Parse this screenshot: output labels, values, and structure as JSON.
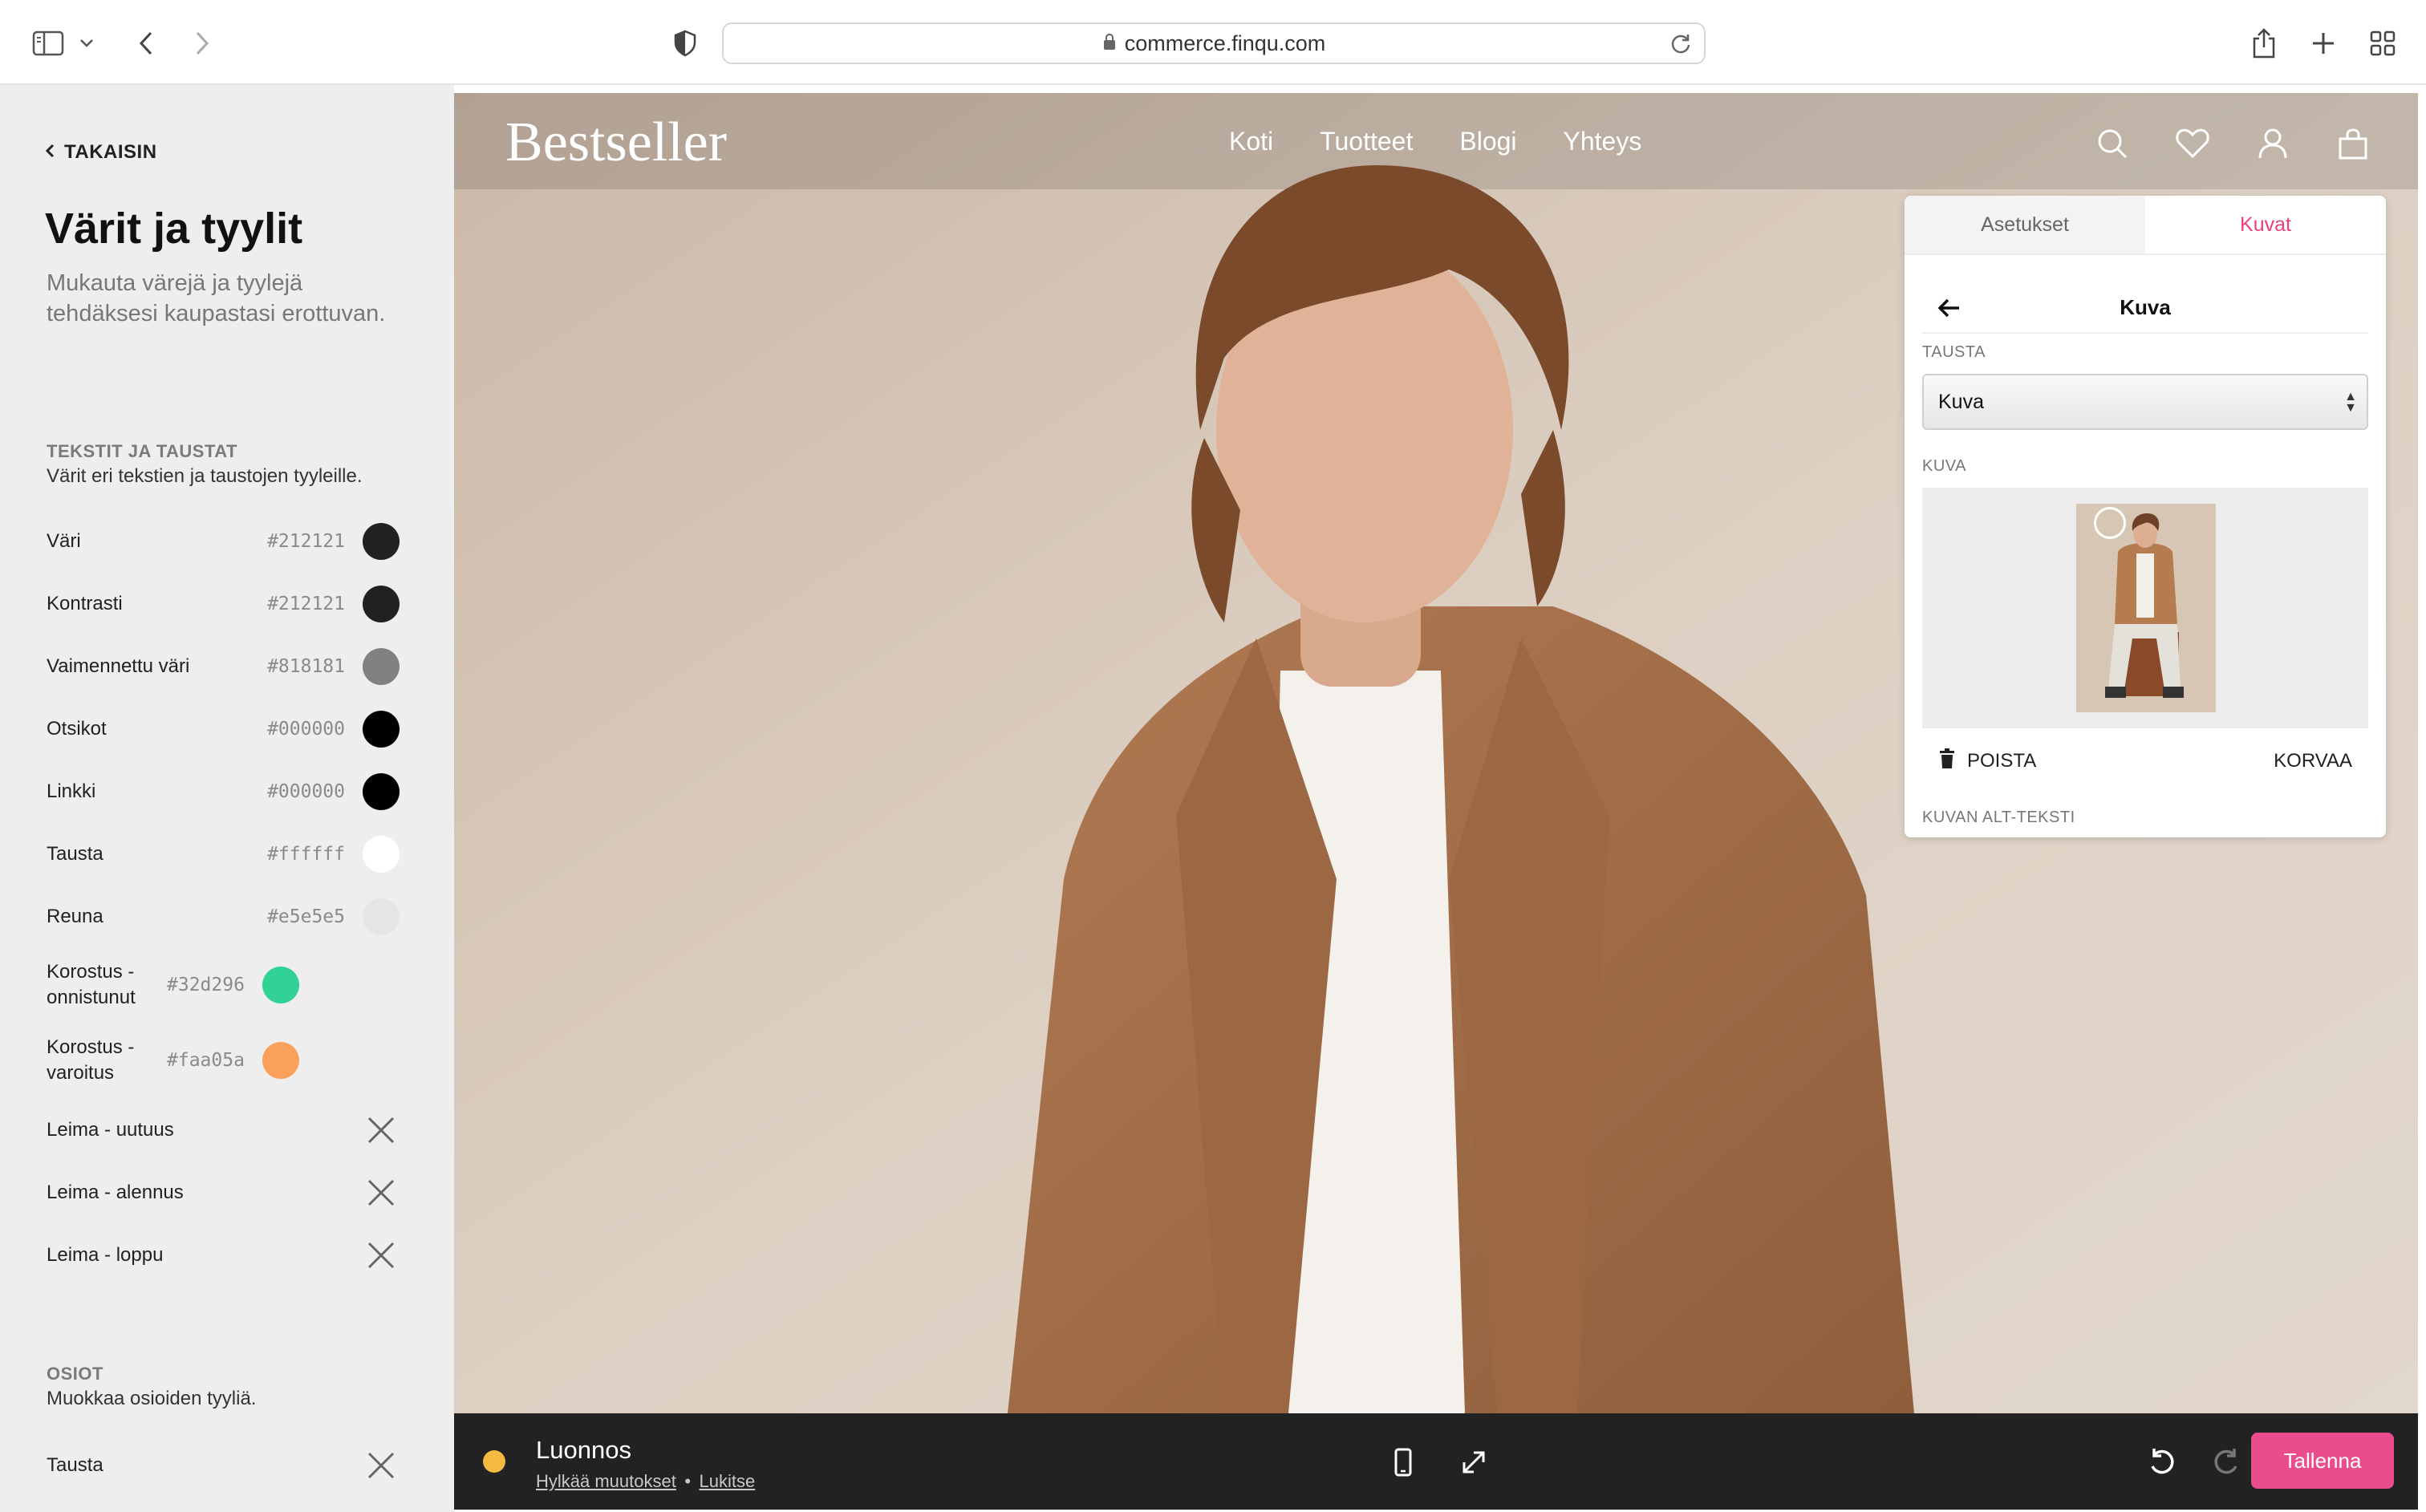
{
  "browser": {
    "url": "commerce.finqu.com",
    "icons": [
      "sidebar-toggle-icon",
      "chevron-down-icon",
      "back-icon",
      "forward-icon",
      "privacy-shield-icon",
      "lock-icon",
      "reload-icon",
      "share-icon",
      "new-tab-icon",
      "tab-overview-icon"
    ]
  },
  "sidebar": {
    "back_label": "TAKAISIN",
    "title": "Värit ja tyylit",
    "description": "Mukauta värejä ja tyylejä tehdäksesi kaupastasi erottuvan.",
    "texts_section": {
      "label": "TEKSTIT JA TAUSTAT",
      "description": "Värit eri tekstien ja taustojen tyyleille.",
      "colors": [
        {
          "label": "Väri",
          "hex": "#212121",
          "color": "#212121"
        },
        {
          "label": "Kontrasti",
          "hex": "#212121",
          "color": "#212121"
        },
        {
          "label": "Vaimennettu väri",
          "hex": "#818181",
          "color": "#818181"
        },
        {
          "label": "Otsikot",
          "hex": "#000000",
          "color": "#000000"
        },
        {
          "label": "Linkki",
          "hex": "#000000",
          "color": "#000000"
        },
        {
          "label": "Tausta",
          "hex": "#ffffff",
          "color": "#ffffff"
        },
        {
          "label": "Reuna",
          "hex": "#e5e5e5",
          "color": "#e5e5e5"
        },
        {
          "label": "Korostus - onnistunut",
          "hex": "#32d296",
          "color": "#32d296"
        },
        {
          "label": "Korostus - varoitus",
          "hex": "#faa05a",
          "color": "#faa05a"
        }
      ],
      "badges": [
        {
          "label": "Leima - uutuus"
        },
        {
          "label": "Leima - alennus"
        },
        {
          "label": "Leima - loppu"
        }
      ]
    },
    "sections_section": {
      "label": "OSIOT",
      "description": "Muokkaa osioiden tyyliä.",
      "items": [
        {
          "label": "Tausta"
        }
      ]
    }
  },
  "preview": {
    "logo": "Bestseller",
    "nav": [
      "Koti",
      "Tuotteet",
      "Blogi",
      "Yhteys"
    ],
    "icons": [
      "search-icon",
      "heart-icon",
      "user-icon",
      "bag-icon"
    ]
  },
  "editor": {
    "tabs": [
      "Asetukset",
      "Kuvat"
    ],
    "active_tab": "Kuvat",
    "panel_title": "Kuva",
    "background_label": "TAUSTA",
    "background_value": "Kuva",
    "image_label": "KUVA",
    "remove_label": "POISTA",
    "replace_label": "KORVAA",
    "alt_text_label": "KUVAN ALT-TEKSTI",
    "accent": "#e8407f"
  },
  "bottom_bar": {
    "status": "Luonnos",
    "discard_label": "Hylkää muutokset",
    "separator": "•",
    "lock_label": "Lukitse",
    "save_label": "Tallenna",
    "status_color": "#f4b942",
    "save_color": "#ea4d8c"
  }
}
